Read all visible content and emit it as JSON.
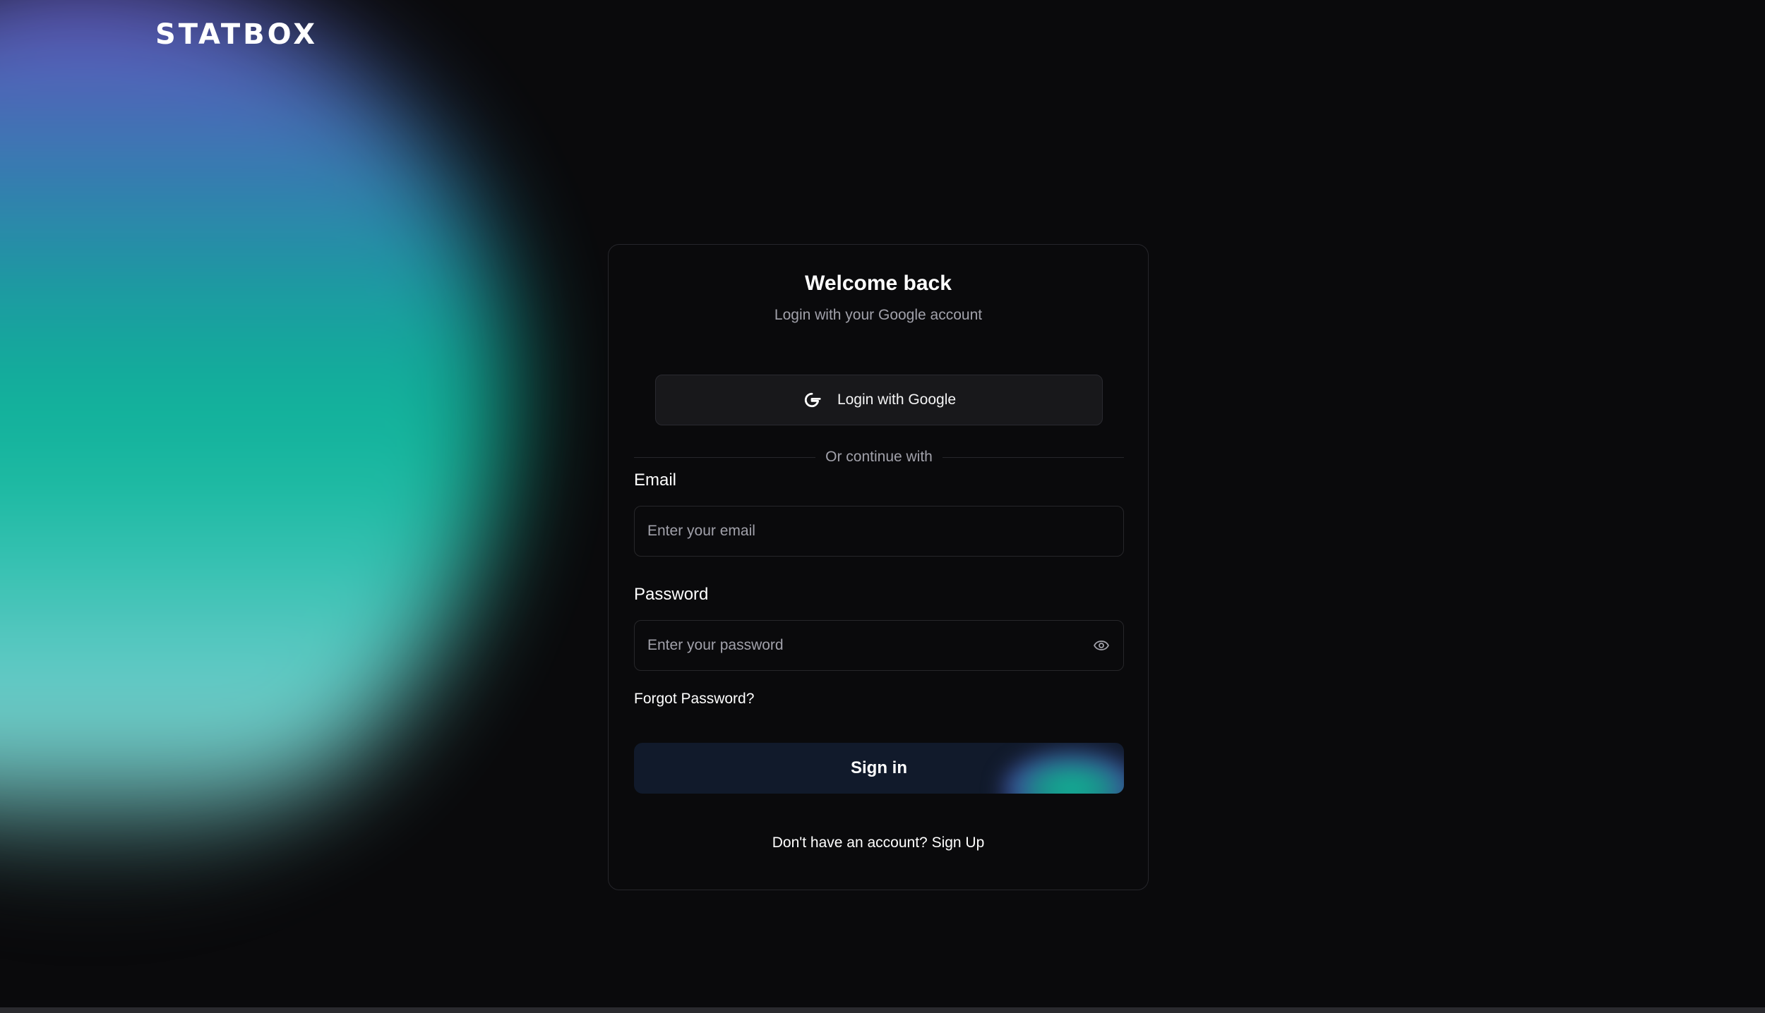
{
  "brand": {
    "logo_text": "STATBOX"
  },
  "card": {
    "title": "Welcome back",
    "subtitle": "Login with your Google account"
  },
  "google_button": {
    "label": "Login with Google",
    "icon": "google-g-icon"
  },
  "divider": {
    "text": "Or continue with"
  },
  "email": {
    "label": "Email",
    "placeholder": "Enter your email",
    "value": ""
  },
  "password": {
    "label": "Password",
    "placeholder": "Enter your password",
    "value": "",
    "toggle_icon": "eye-icon"
  },
  "forgot_password": {
    "label": "Forgot Password?"
  },
  "signin_button": {
    "label": "Sign in"
  },
  "signup": {
    "prompt": "Don't have an account?",
    "link": "Sign Up"
  },
  "colors": {
    "background": "#0a0a0c",
    "card_border": "#26262b",
    "button_bg": "#18181b",
    "signin_bg": "#111a2b",
    "muted_text": "#a1a1aa",
    "accent_teal": "#11bfa2",
    "accent_purple": "#6f56c8"
  }
}
